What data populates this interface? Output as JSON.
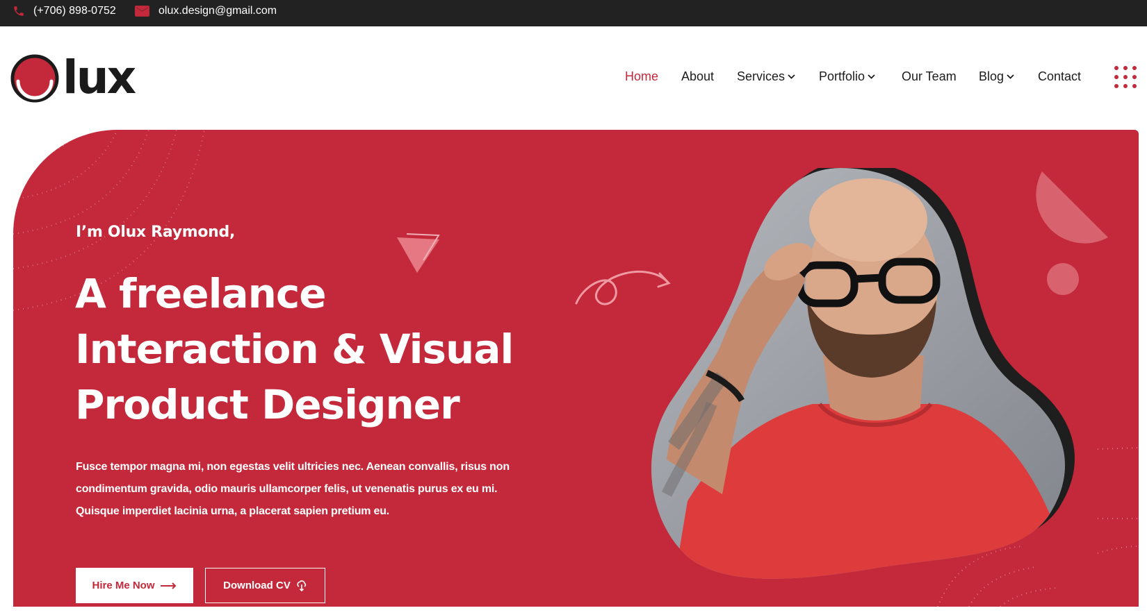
{
  "topbar": {
    "phone": "(+706) 898-0752",
    "email": "olux.design@gmail.com",
    "phone_icon": "phone-icon",
    "email_icon": "envelope-icon"
  },
  "brand": {
    "logo_text": "lux",
    "accent_color": "#c3293a",
    "dark_color": "#222222"
  },
  "nav": {
    "items": [
      {
        "label": "Home",
        "active": true
      },
      {
        "label": "About"
      },
      {
        "label": "Services",
        "has_dropdown": true
      },
      {
        "label": "Portfolio",
        "has_dropdown": true
      },
      {
        "label": "Our Team"
      },
      {
        "label": "Blog",
        "has_dropdown": true
      },
      {
        "label": "Contact"
      }
    ],
    "menu_icon": "dots-grid-icon"
  },
  "hero": {
    "intro": "I’m Olux Raymond,",
    "headline_lines": [
      "A freelance",
      "Interaction & Visual",
      "Product Designer"
    ],
    "description_lines": [
      "Fusce tempor magna mi, non egestas velit ultricies nec. Aenean convallis, risus non",
      "condimentum gravida, odio mauris ullamcorper felis, ut venenatis purus ex eu mi.",
      "Quisque imperdiet lacinia urna, a placerat sapien pretium eu."
    ],
    "primary_button": "Hire Me Now",
    "secondary_button": "Download CV",
    "background_color": "#c3293a"
  }
}
